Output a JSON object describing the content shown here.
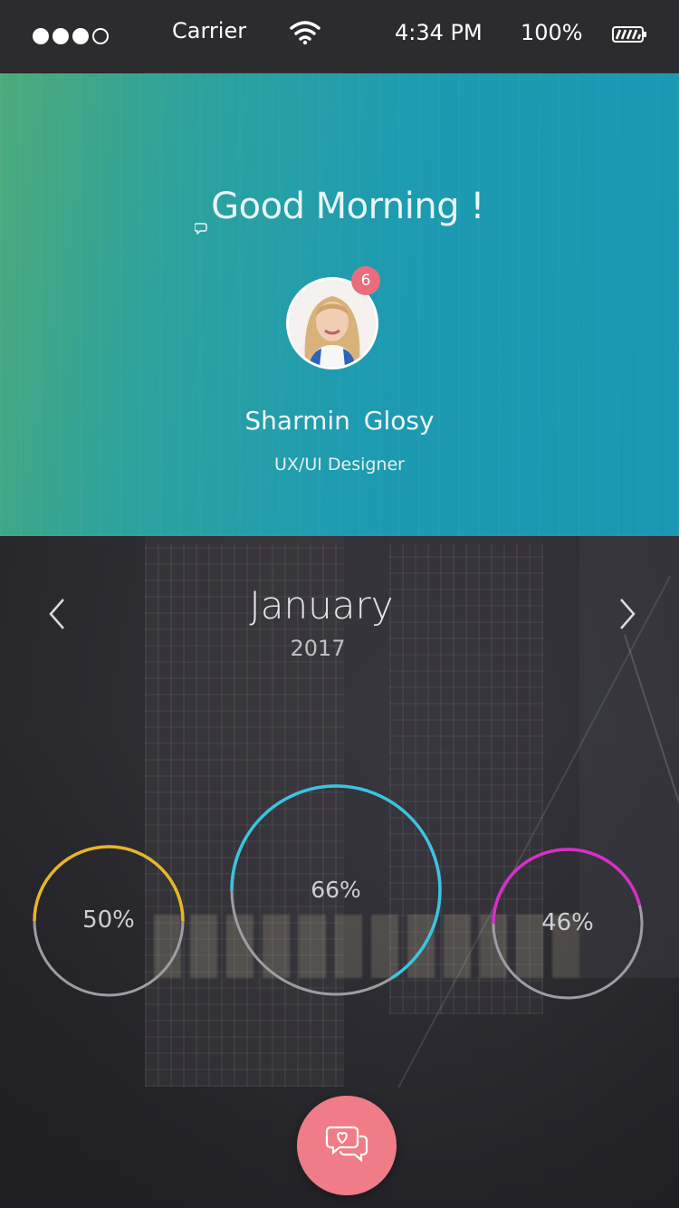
{
  "status_bar": {
    "carrier": "Carrier",
    "time": "4:34 PM",
    "battery": "100%",
    "signal_bars_filled": 3,
    "signal_bars_total": 4
  },
  "header": {
    "greeting": "Good Morning !",
    "notification_count": "6",
    "user_name": "Sharmin  Glosy",
    "user_role": "UX/UI Designer",
    "gradient_start": "#4fb07d",
    "gradient_end": "#1a9bb6"
  },
  "calendar": {
    "month": "January",
    "year": "2017",
    "prev_icon": "chevron-left-icon",
    "next_icon": "chevron-right-icon"
  },
  "stats": [
    {
      "label": "50%",
      "value": 0.5,
      "color": "#e6b62a"
    },
    {
      "label": "66%",
      "value": 0.66,
      "color": "#3bc4e0"
    },
    {
      "label": "46%",
      "value": 0.46,
      "color": "#d82fc8"
    }
  ],
  "fab": {
    "icon": "chat-heart-icon",
    "color": "#ef7c86"
  }
}
